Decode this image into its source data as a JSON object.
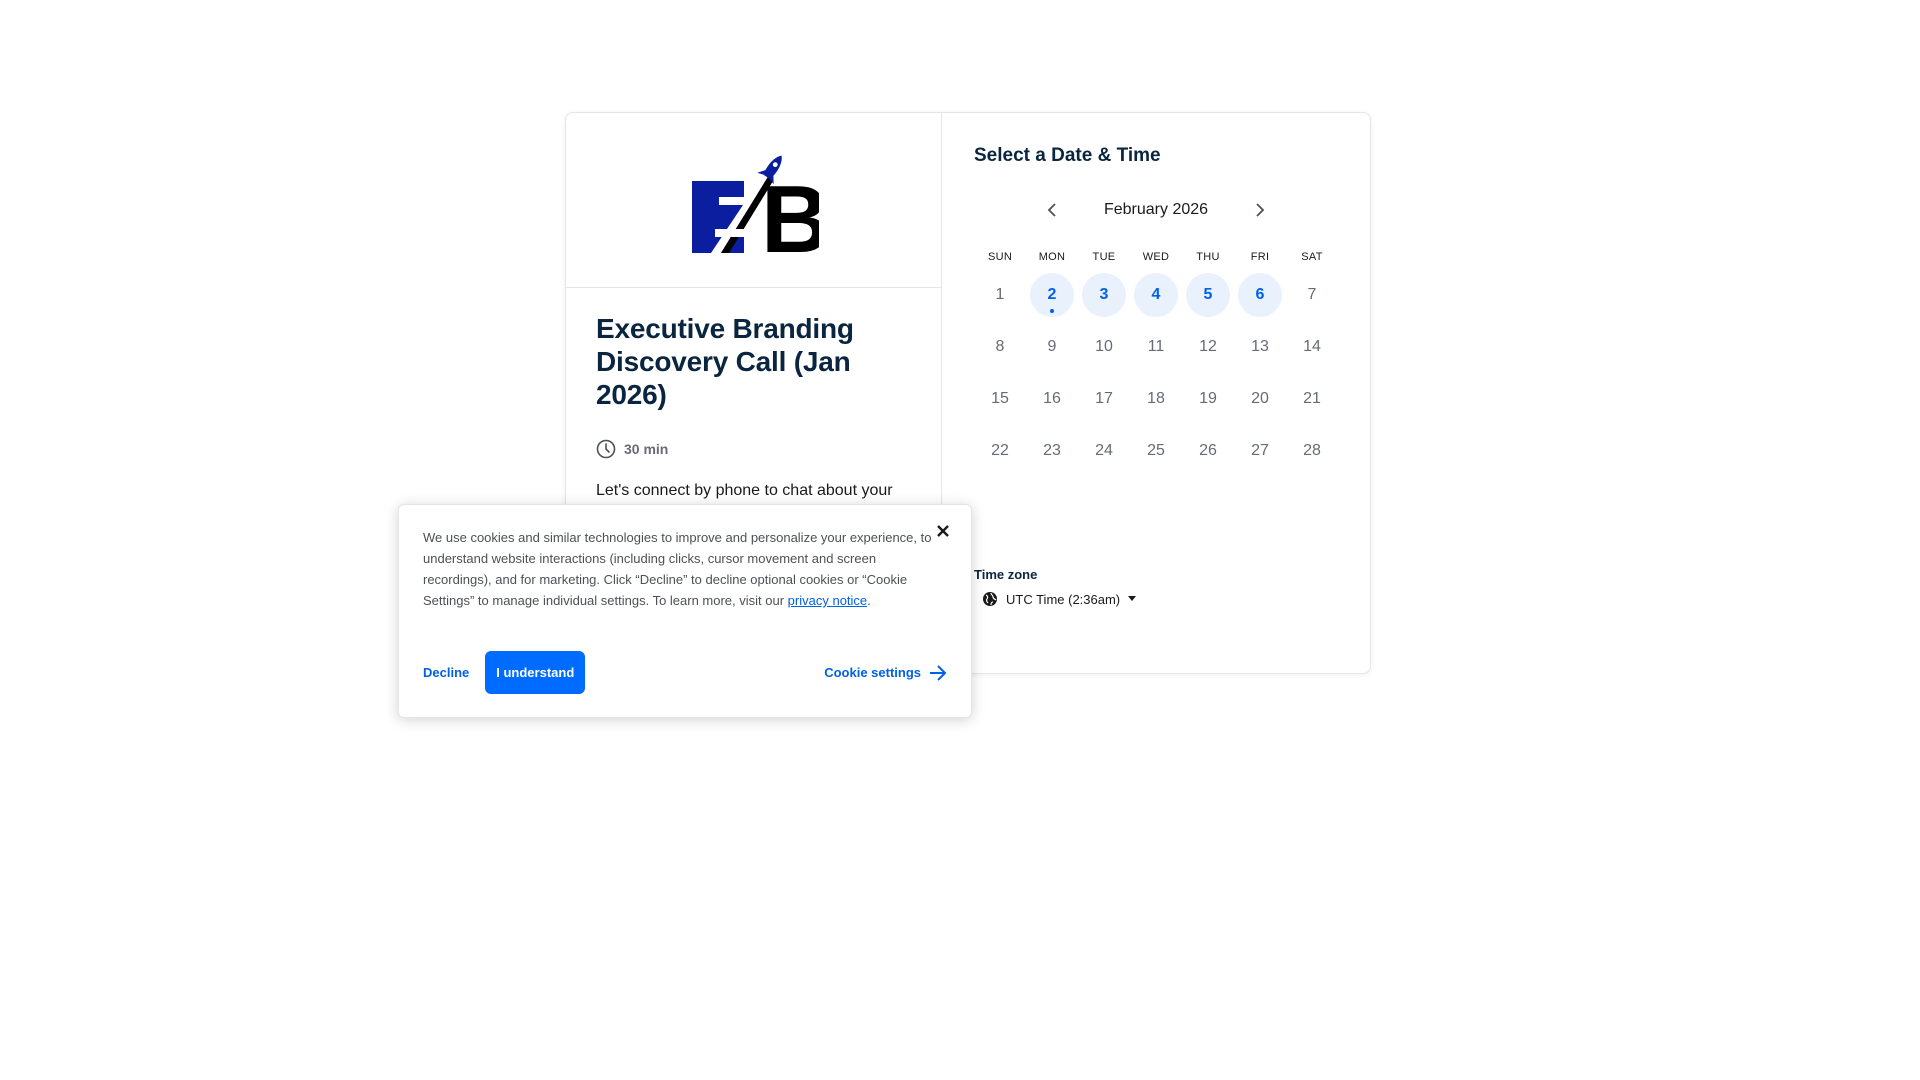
{
  "event": {
    "logo_text": "EB",
    "title": "Executive Branding Discovery Call (Jan 2026)",
    "duration": "30 min",
    "description": "Let's connect by phone to chat about your current situation and needs."
  },
  "scheduler": {
    "heading": "Select a Date & Time",
    "month_label": "February 2026",
    "weekdays": [
      "SUN",
      "MON",
      "TUE",
      "WED",
      "THU",
      "FRI",
      "SAT"
    ],
    "days": [
      {
        "num": "1",
        "available": false,
        "today": false
      },
      {
        "num": "2",
        "available": true,
        "today": true
      },
      {
        "num": "3",
        "available": true,
        "today": false
      },
      {
        "num": "4",
        "available": true,
        "today": false
      },
      {
        "num": "5",
        "available": true,
        "today": false
      },
      {
        "num": "6",
        "available": true,
        "today": false
      },
      {
        "num": "7",
        "available": false,
        "today": false
      },
      {
        "num": "8",
        "available": false,
        "today": false
      },
      {
        "num": "9",
        "available": false,
        "today": false
      },
      {
        "num": "10",
        "available": false,
        "today": false
      },
      {
        "num": "11",
        "available": false,
        "today": false
      },
      {
        "num": "12",
        "available": false,
        "today": false
      },
      {
        "num": "13",
        "available": false,
        "today": false
      },
      {
        "num": "14",
        "available": false,
        "today": false
      },
      {
        "num": "15",
        "available": false,
        "today": false
      },
      {
        "num": "16",
        "available": false,
        "today": false
      },
      {
        "num": "17",
        "available": false,
        "today": false
      },
      {
        "num": "18",
        "available": false,
        "today": false
      },
      {
        "num": "19",
        "available": false,
        "today": false
      },
      {
        "num": "20",
        "available": false,
        "today": false
      },
      {
        "num": "21",
        "available": false,
        "today": false
      },
      {
        "num": "22",
        "available": false,
        "today": false
      },
      {
        "num": "23",
        "available": false,
        "today": false
      },
      {
        "num": "24",
        "available": false,
        "today": false
      },
      {
        "num": "25",
        "available": false,
        "today": false
      },
      {
        "num": "26",
        "available": false,
        "today": false
      },
      {
        "num": "27",
        "available": false,
        "today": false
      },
      {
        "num": "28",
        "available": false,
        "today": false
      }
    ],
    "timezone_label": "Time zone",
    "timezone_value": "UTC Time (2:36am)"
  },
  "cookie_banner": {
    "text": "We use cookies and similar technologies to improve and personalize your experience, to understand website interactions (including clicks, cursor movement and screen recordings), and for marketing. Click “Decline” to decline optional cookies or “Cookie Settings” to manage individual settings. To learn more, visit our ",
    "link_text": "privacy notice",
    "link_suffix": ".",
    "decline_label": "Decline",
    "accept_label": "I understand",
    "settings_label": "Cookie settings"
  },
  "colors": {
    "brand_navy": "#0b1ea0",
    "primary_blue": "#006bff",
    "available_bg": "#e9f1fd"
  },
  "icons": [
    "rocket-logo",
    "clock-icon",
    "chevron-left-icon",
    "chevron-right-icon",
    "globe-icon",
    "caret-down-icon",
    "close-icon",
    "arrow-right-icon"
  ]
}
